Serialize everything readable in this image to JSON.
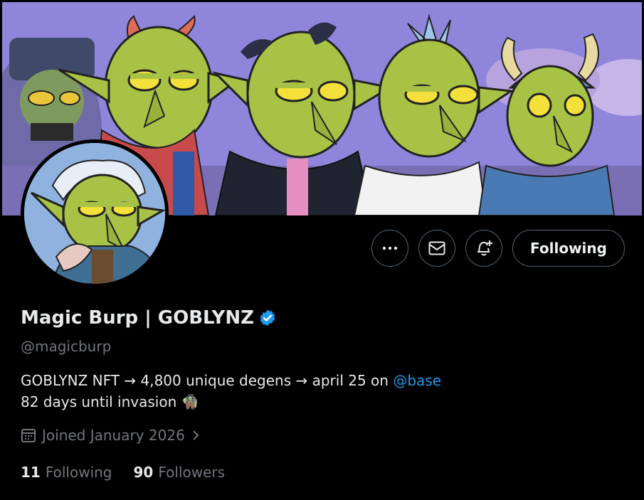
{
  "profile": {
    "display_name": "Magic Burp | GOBLYNZ",
    "handle": "@magicburp",
    "bio_line1_prefix": "GOBLYNZ NFT → 4,800 unique degens → april 25 on ",
    "bio_mention": "@base",
    "bio_line2": "82 days until invasion 🧌",
    "joined": "Joined January 2026",
    "following_count": "11",
    "following_label": "Following",
    "followers_count": "90",
    "followers_label": "Followers",
    "verified": true
  },
  "actions": {
    "more_icon": "more-icon",
    "message_icon": "envelope-icon",
    "notify_icon": "bell-plus-icon",
    "follow_label": "Following"
  },
  "colors": {
    "background": "#000000",
    "accent": "#1d9bf0",
    "muted": "#71767b",
    "banner_bg": "#8f86dc",
    "goblin_skin": "#a8c246"
  }
}
